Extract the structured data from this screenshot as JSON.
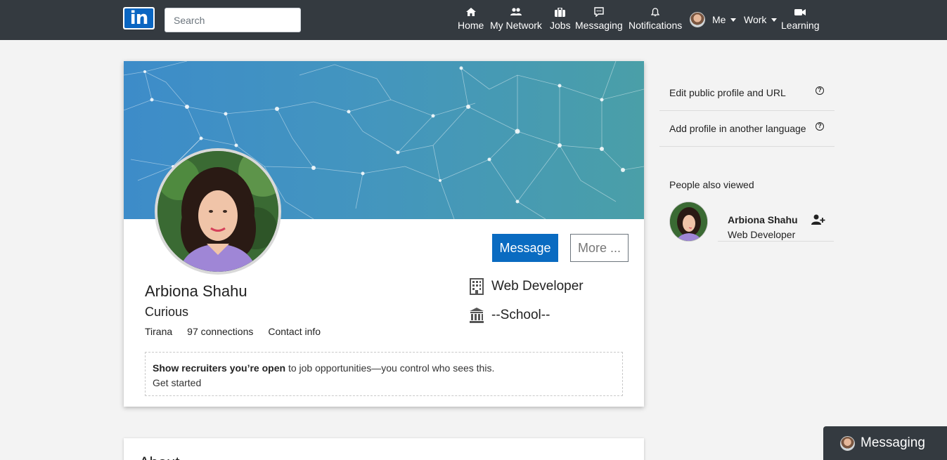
{
  "nav": {
    "logo_text": "in",
    "search_placeholder": "Search",
    "items": [
      {
        "label": "Home",
        "icon": "home-icon"
      },
      {
        "label": "My Network",
        "icon": "network-icon"
      },
      {
        "label": "Jobs",
        "icon": "briefcase-icon"
      },
      {
        "label": "Messaging",
        "icon": "message-icon"
      },
      {
        "label": "Notifications",
        "icon": "bell-icon"
      }
    ],
    "me_label": "Me",
    "work_label": "Work",
    "learning_label": "Learning"
  },
  "profile": {
    "name": "Arbiona Shahu",
    "headline": "Curious",
    "location": "Tirana",
    "connections": "97 connections",
    "contact_info": "Contact info",
    "message_button": "Message",
    "more_button": "More ...",
    "position": "Web Developer",
    "school": "--School--",
    "recruiter_bold": "Show recruiters you’re open",
    "recruiter_rest": " to job opportunities—you control who sees this.",
    "get_started": "Get started"
  },
  "about": {
    "title": "About"
  },
  "sidebar": {
    "edit_public_profile": "Edit public profile and URL",
    "add_language": "Add profile in another language",
    "help_glyph": "?",
    "people_also_viewed_title": "People also viewed",
    "people": [
      {
        "name": "Arbiona Shahu",
        "role": "Web Developer"
      }
    ]
  },
  "messaging_dock": {
    "label": "Messaging"
  },
  "colors": {
    "navbar": "#343a40",
    "accent": "#0a6bc1",
    "page_bg": "#f3f3f3"
  }
}
